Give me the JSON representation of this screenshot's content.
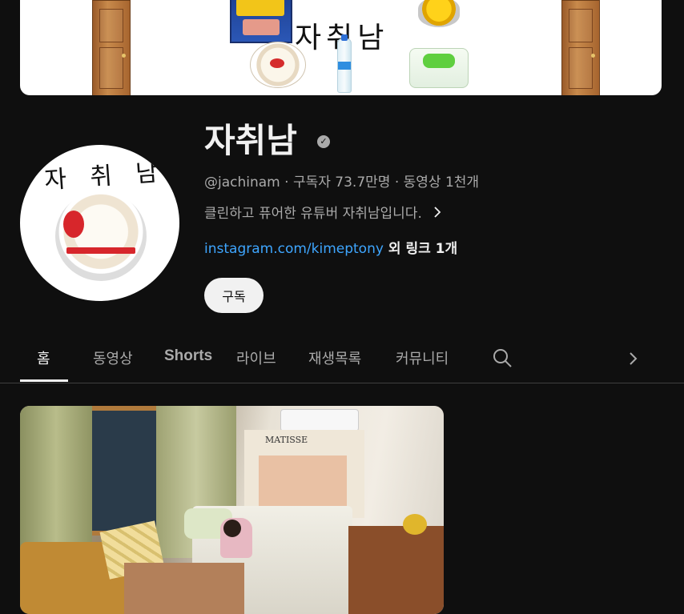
{
  "banner": {
    "title": "자취남",
    "products": [
      "door-image",
      "spam-can-image",
      "tuna-can-image",
      "rice-bowl-image",
      "water-bottle-image",
      "wet-wipes-image",
      "door-image"
    ]
  },
  "avatar": {
    "text": "자 취 남",
    "image": "rice-bowl-image"
  },
  "channel": {
    "name": "자취남",
    "verified": true,
    "handle": "@jachinam",
    "separator": " · ",
    "subscribers": "구독자 73.7만명",
    "videos": "동영상 1천개",
    "description": "클린하고 퓨어한 유튜버 자취남입니다.",
    "link_url": "instagram.com/kimeptony",
    "more_links": "외 링크 1개",
    "subscribe_label": "구독"
  },
  "tabs": [
    {
      "label": "홈",
      "active": true
    },
    {
      "label": "동영상",
      "active": false
    },
    {
      "label": "Shorts",
      "active": false
    },
    {
      "label": "라이브",
      "active": false
    },
    {
      "label": "재생목록",
      "active": false
    },
    {
      "label": "커뮤니티",
      "active": false
    }
  ],
  "icons": {
    "search": "search-icon",
    "next": "chevron-right-icon",
    "verified": "verified-badge-icon",
    "description_more": "chevron-right-icon"
  },
  "featured_video": {
    "thumbnail_poster_text": "MATISSE"
  },
  "colors": {
    "background": "#0f0f0f",
    "text_primary": "#f1f1f1",
    "text_secondary": "#aaaaaa",
    "link": "#3ea6ff",
    "subscribe_bg": "#f1f1f1"
  }
}
